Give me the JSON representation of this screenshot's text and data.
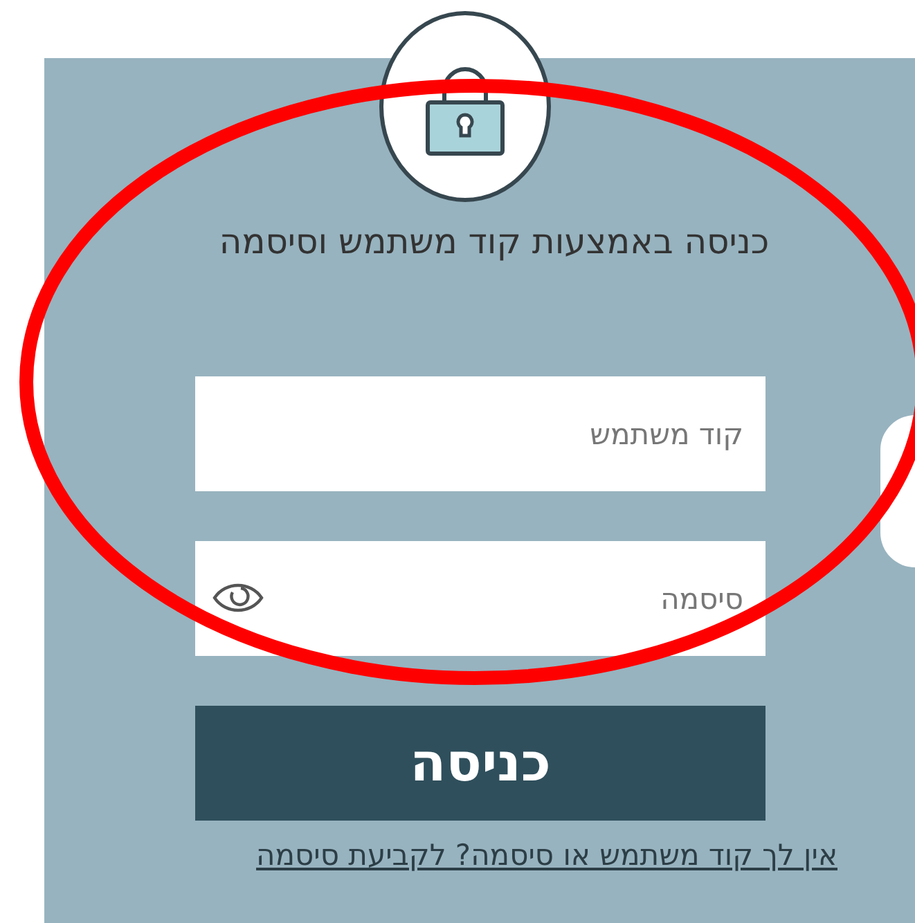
{
  "title": "כניסה באמצעות קוד משתמש וסיסמה",
  "fields": [
    {
      "kind": "text",
      "placeholder": "קוד משתמש"
    },
    {
      "kind": "password",
      "placeholder": "סיסמה"
    }
  ],
  "submit": "כניסה",
  "help_link": "אין לך קוד משתמש או סיסמה? לקביעת סיסמה"
}
